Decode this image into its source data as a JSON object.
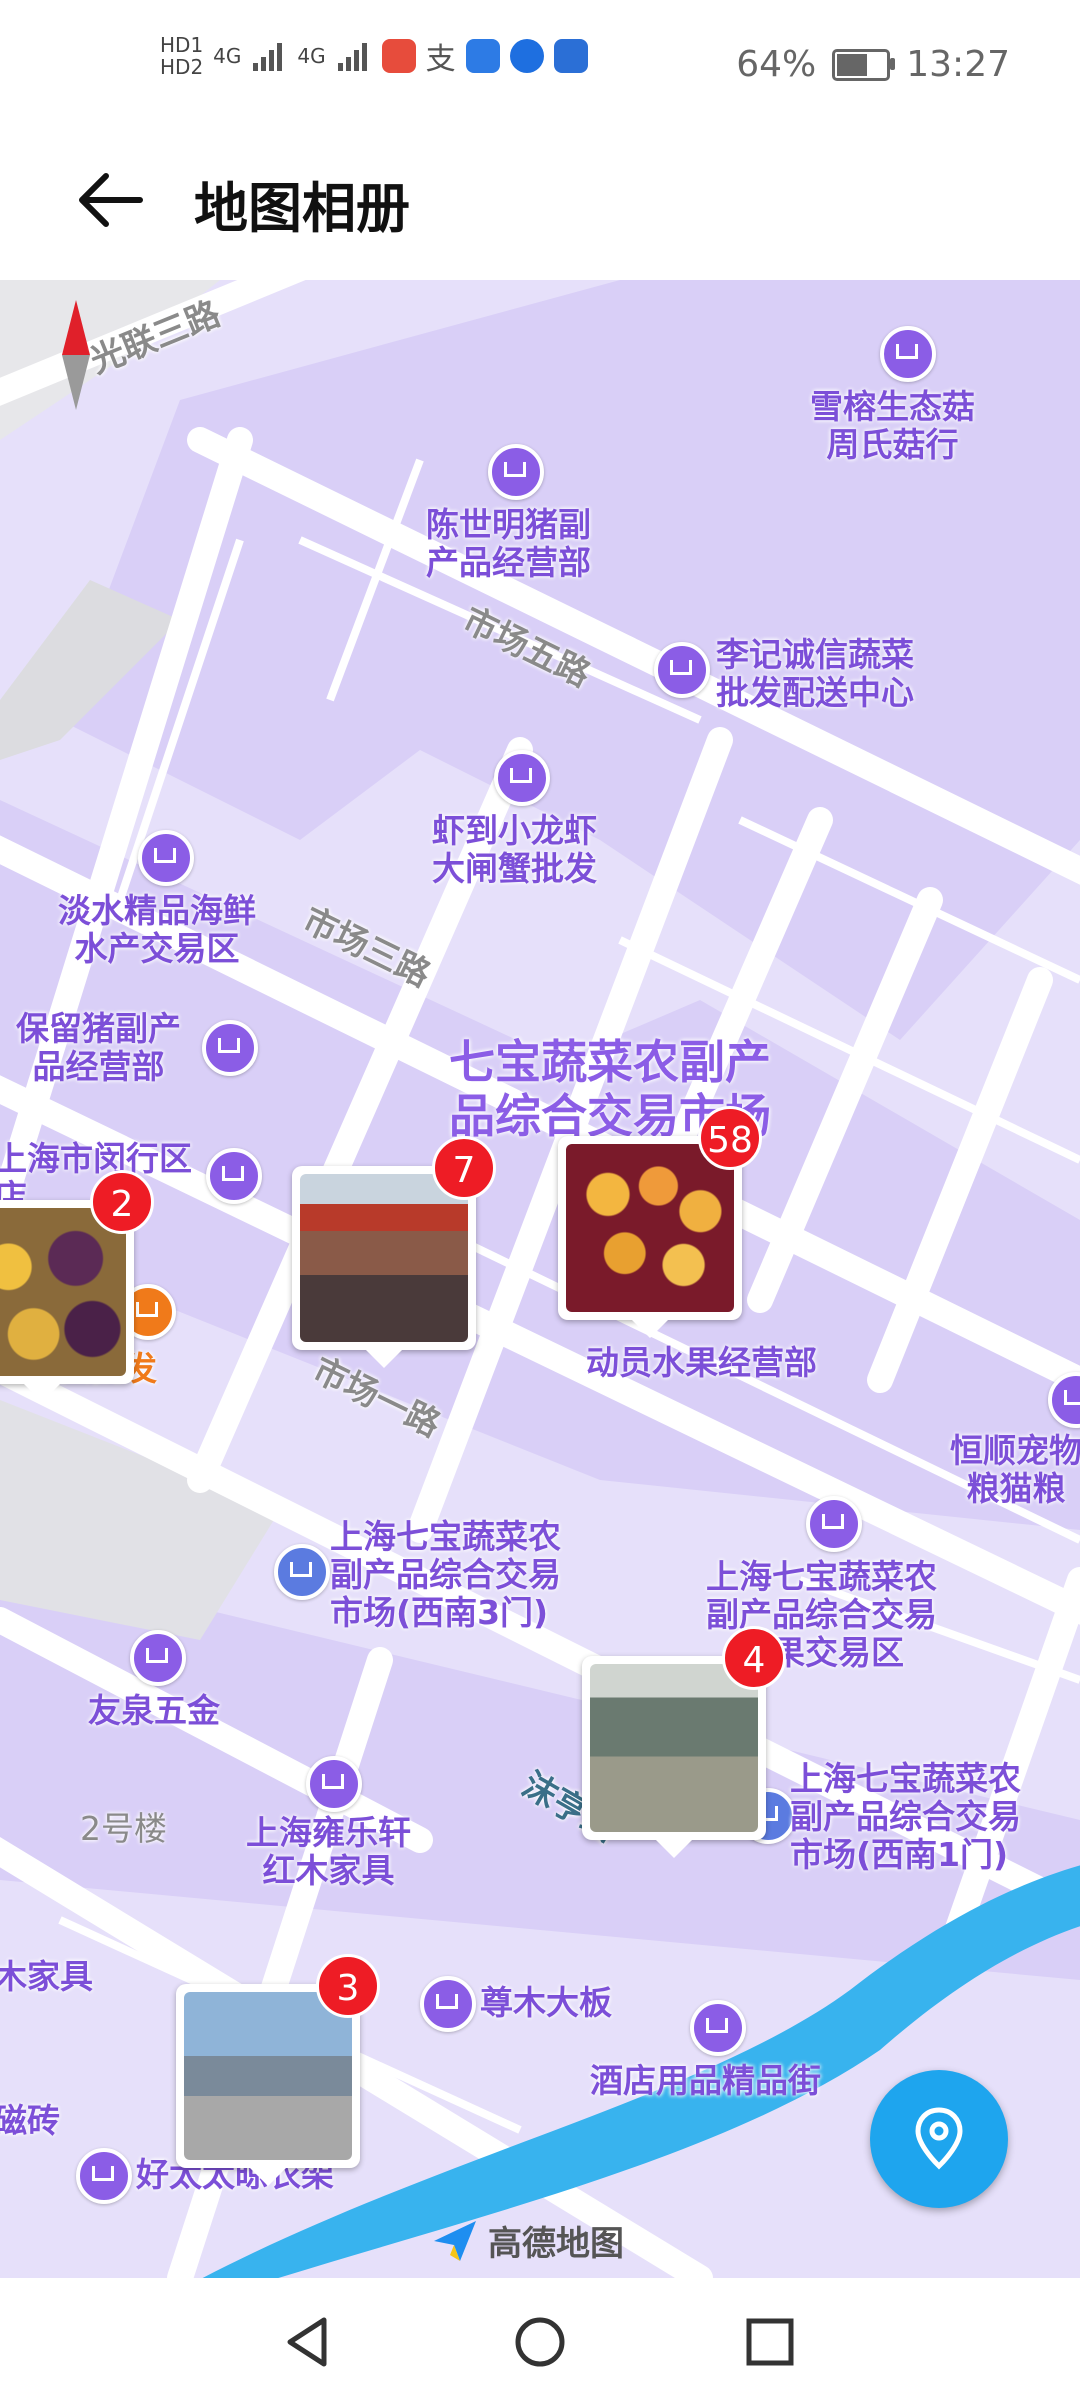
{
  "status_bar": {
    "battery_percent": "64%",
    "time": "13:27",
    "hd1": "HD1",
    "hd2": "HD2",
    "net1": "4G",
    "net2": "4G",
    "battery_level": 0.64
  },
  "app_bar": {
    "title": "地图相册",
    "back_icon": "arrow-left-icon"
  },
  "map": {
    "roads": [
      "光联三路",
      "市场五路",
      "市场三路",
      "市场一路",
      "沫亨路"
    ],
    "region": "七宝蔬菜农副产品综合交易市场",
    "pois": [
      {
        "label": "雪榕生态菇\n周氏菇行"
      },
      {
        "label": "陈世明猪副\n产品经营部"
      },
      {
        "label": "李记诚信蔬菜\n批发配送中心"
      },
      {
        "label": "虾到小龙虾\n大闸蟹批发"
      },
      {
        "label": "淡水精品海鲜\n水产交易区"
      },
      {
        "label": "保留猪副产\n品经营部"
      },
      {
        "label": "上海市闵行区\n店"
      },
      {
        "label": "头批发"
      },
      {
        "label": "动员水果经营部"
      },
      {
        "label": "恒顺宠物\n粮猫粮"
      },
      {
        "label": "上海七宝蔬菜农\n副产品综合交易\n市场(西南3门)"
      },
      {
        "label": "上海七宝蔬菜农\n副产品综合交易\n水果交易区"
      },
      {
        "label": "友泉五金"
      },
      {
        "label": "2号楼"
      },
      {
        "label": "上海雍乐轩\n红木家具"
      },
      {
        "label": "上海七宝蔬菜农\n副产品综合交易\n市场(西南1门)"
      },
      {
        "label": "木家具"
      },
      {
        "label": "尊木大板"
      },
      {
        "label": "酒店用品精品街"
      },
      {
        "label": "磁砖"
      },
      {
        "label": "好太太晾衣架"
      }
    ],
    "photo_clusters": [
      {
        "count": "2"
      },
      {
        "count": "7"
      },
      {
        "count": "58"
      },
      {
        "count": "4"
      },
      {
        "count": "3"
      }
    ],
    "logo_text": "高德地图"
  },
  "nav_bar": {
    "back": "nav-back-icon",
    "home": "nav-home-icon",
    "recents": "nav-recents-icon"
  }
}
